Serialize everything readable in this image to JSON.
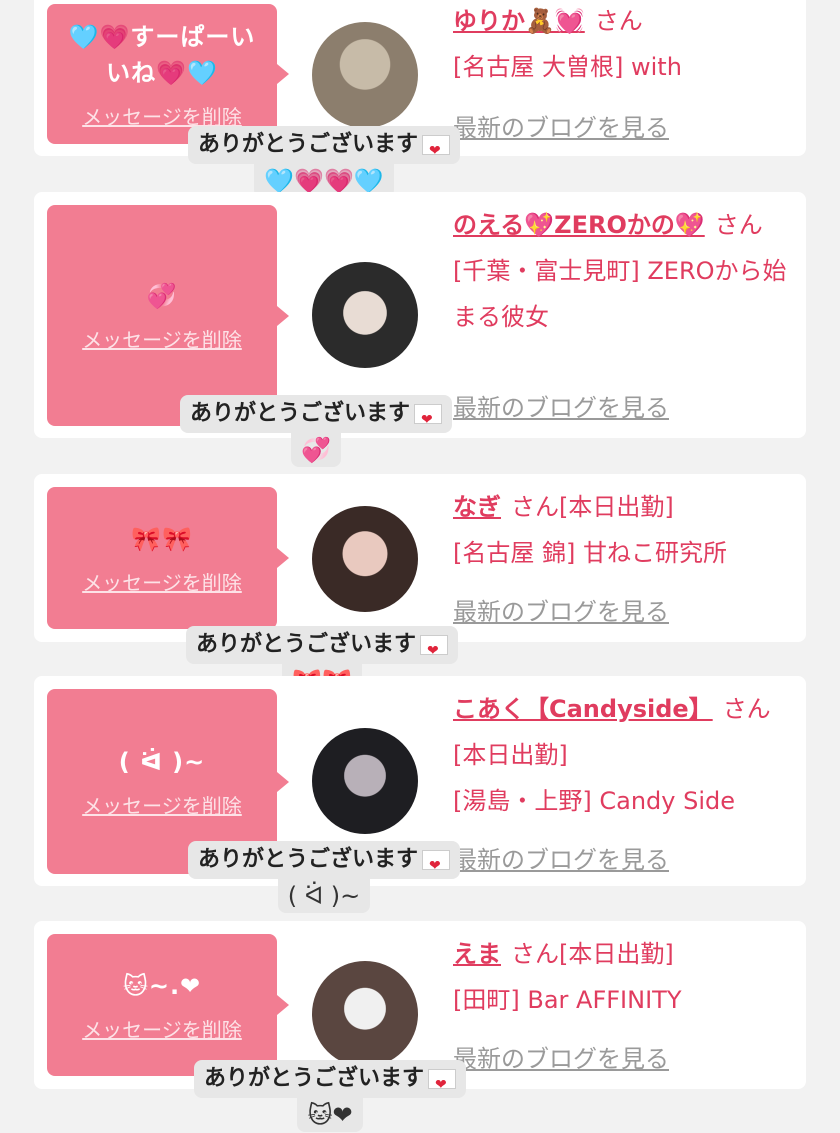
{
  "common": {
    "delete_label": "メッセージを削除",
    "blog_label": "最新のブログを見る",
    "san": "さん",
    "thanks": "ありがとうございます"
  },
  "cards": [
    {
      "message": "🩵💗すーぱーいいね💗🩵",
      "name": "ゆりか🧸💓",
      "status": "",
      "shop": "[名古屋 大曽根] with",
      "reply_emoji": "🩵💗💗🩵",
      "avatar_colors": [
        "#8c7e6d",
        "#c7bba8"
      ]
    },
    {
      "message": "💞",
      "name": "のえる💖ZEROかの💖",
      "status": "",
      "shop": "[千葉・富士見町] ZEROから始まる彼女",
      "reply_emoji": "💞",
      "avatar_colors": [
        "#2b2b2b",
        "#e8dcd4"
      ]
    },
    {
      "message": "🎀🎀",
      "name": "なぎ",
      "status": "[本日出勤]",
      "shop": "[名古屋 錦] 甘ねこ研究所",
      "reply_emoji": "🎀🎀",
      "avatar_colors": [
        "#3a2a26",
        "#e9c9bf"
      ]
    },
    {
      "message": "( ᐛ )~",
      "name": "こあく【Candyside】",
      "status": "[本日出勤]",
      "shop": "[湯島・上野] Candy Side",
      "reply_emoji": "( ᐛ )~",
      "avatar_colors": [
        "#1e1e22",
        "#b8b0b8"
      ]
    },
    {
      "message": "🐱~.❤",
      "name": "えま",
      "status": "[本日出勤]",
      "shop": "[田町] Bar AFFINITY",
      "reply_emoji": "🐱❤",
      "avatar_colors": [
        "#5a4640",
        "#f0f0f0"
      ]
    }
  ]
}
